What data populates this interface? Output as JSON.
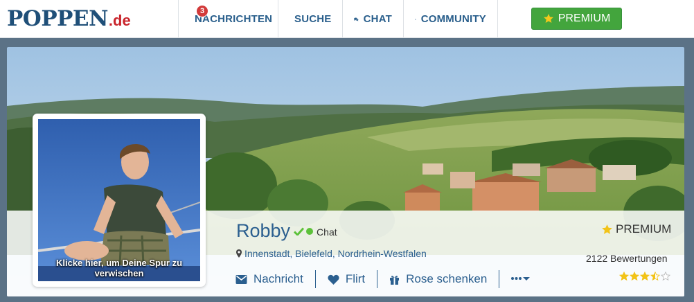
{
  "header": {
    "logo_main": "POPPEN",
    "logo_tld": ".de",
    "nav": [
      {
        "label": "NACHRICHTEN",
        "icon": "envelope-icon",
        "badge": "3"
      },
      {
        "label": "SUCHE",
        "icon": "search-icon"
      },
      {
        "label": "CHAT",
        "icon": "chat-bubbles-icon"
      },
      {
        "label": "COMMUNITY",
        "icon": "users-icon"
      }
    ],
    "premium_label": "PREMIUM",
    "premium_icon": "star-icon"
  },
  "profile": {
    "name": "Robby",
    "verified_icon": "checkmark-icon",
    "online_status": "Chat",
    "location_icon": "map-marker-icon",
    "location": [
      "Innenstadt",
      "Bielefeld",
      "Nordrhein-Westfalen"
    ],
    "avatar_caption": "Klicke hier, um Deine Spur zu verwischen",
    "premium_label": "PREMIUM",
    "reviews_text": "2122 Bewertungen",
    "rating": 3.5,
    "rating_max": 5,
    "actions": [
      {
        "label": "Nachricht",
        "icon": "envelope-icon"
      },
      {
        "label": "Flirt",
        "icon": "heart-icon"
      },
      {
        "label": "Rose schenken",
        "icon": "gift-icon"
      },
      {
        "label": "",
        "icon": "more-dots-icon"
      }
    ]
  },
  "colors": {
    "brand_blue": "#1f4f78",
    "brand_red": "#c9252c",
    "link_blue": "#2b5f8f",
    "premium_green": "#43a53d",
    "online_green": "#5cc13a",
    "star_gold": "#f2c318",
    "badge_red": "#d23a3a"
  }
}
